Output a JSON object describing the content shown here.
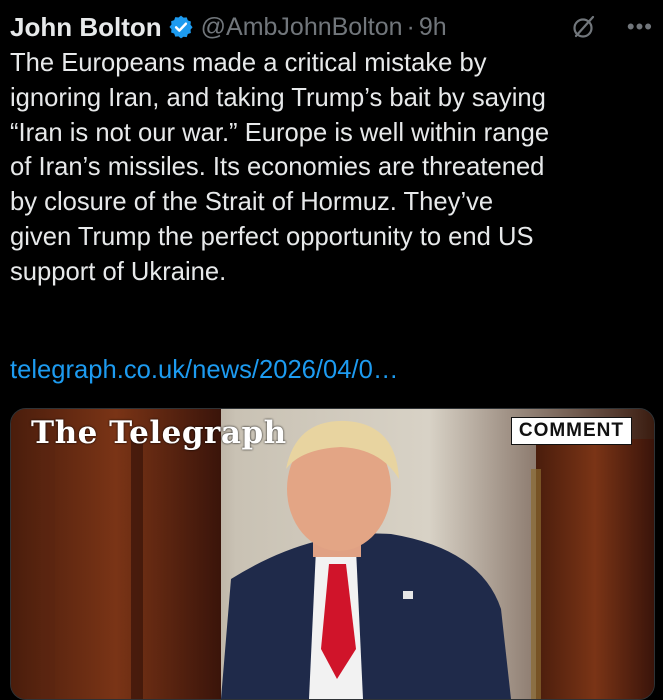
{
  "tweet": {
    "author_name": "John Bolton",
    "handle": "@AmbJohnBolton",
    "separator": "·",
    "time": "9h",
    "verified_icon": "verified-badge-icon",
    "text_lines": [
      "The Europeans made a critical mistake by",
      "ignoring Iran, and taking Trump’s bait by saying",
      "“Iran is not our war.” Europe is well within range",
      "of Iran’s missiles. Its economies are threatened",
      "by closure of the Strait of Hormuz. They’ve",
      "given Trump the perfect opportunity to end US",
      "support of Ukraine."
    ],
    "link_text": "telegraph.co.uk/news/2026/04/0…"
  },
  "media": {
    "masthead": "The Telegraph",
    "badge": "COMMENT"
  },
  "icons": {
    "grok": "grok-icon",
    "more": "more-icon"
  },
  "colors": {
    "background": "#000000",
    "text": "#e7e9ea",
    "secondary": "#71767b",
    "link": "#1d9bf0",
    "verified": "#1d9bf0"
  }
}
